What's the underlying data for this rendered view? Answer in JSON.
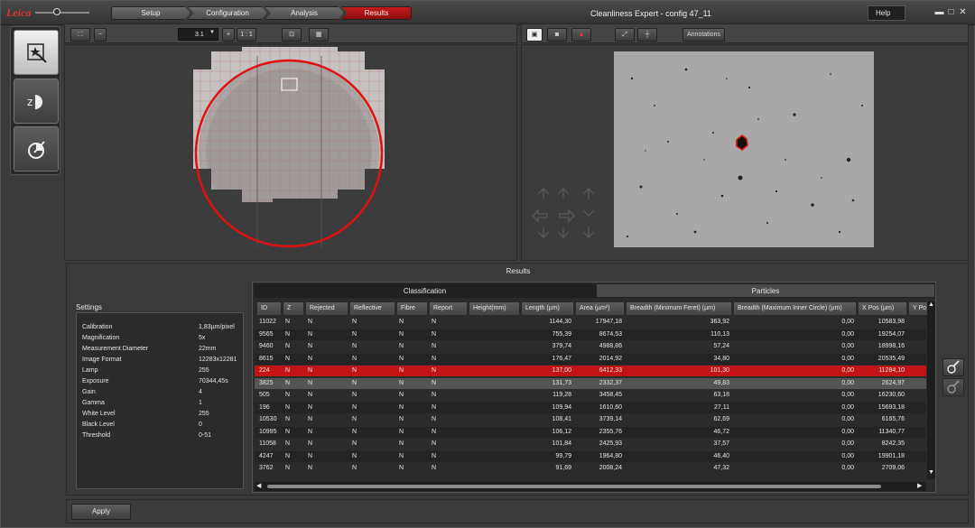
{
  "titlebar": {
    "logo": "Leica",
    "workflow": [
      "Setup",
      "Configuration",
      "Analysis",
      "Results"
    ],
    "active_step": "Results",
    "app_title": "Cleanliness Expert - config 47_11",
    "help_label": "Help"
  },
  "toolbar_left": {
    "zoom_value": "3.1",
    "zoom_minus": "−",
    "zoom_plus": "+",
    "zoom_reset": "1 : 1"
  },
  "toolbar_right": {
    "annotations_label": "Annotations"
  },
  "results": {
    "title": "Results",
    "group_classification": "Classification",
    "group_particles": "Particles",
    "settings_title": "Settings",
    "settings": [
      {
        "key": "Calibration",
        "value": "1,83µm/pixel"
      },
      {
        "key": "Magnification",
        "value": "5x"
      },
      {
        "key": "Measurement Diameter",
        "value": "22mm"
      },
      {
        "key": "Image Format",
        "value": "12283x12281"
      },
      {
        "key": "Lamp",
        "value": "255"
      },
      {
        "key": "Exposure",
        "value": "70344,45s"
      },
      {
        "key": "Gain",
        "value": "4"
      },
      {
        "key": "Gamma",
        "value": "1"
      },
      {
        "key": "White Level",
        "value": "255"
      },
      {
        "key": "Black Level",
        "value": "0"
      },
      {
        "key": "Threshold",
        "value": "0-51"
      }
    ],
    "columns": [
      "ID",
      "Z",
      "Rejected",
      "Reflective",
      "Fibre",
      "Report",
      "Height(mm)",
      "Length (µm)",
      "Area (µm²)",
      "Breadth (Minimum Feret) (µm)",
      "Breadth (Maximum Inner Circle) (µm)",
      "X Pos (µm)",
      "Y Po"
    ],
    "rows": [
      [
        "11022",
        "N",
        "N",
        "N",
        "N",
        "N",
        "",
        "1144,30",
        "17947,18",
        "363,92",
        "0,00",
        "10583,98"
      ],
      [
        "9565",
        "N",
        "N",
        "N",
        "N",
        "N",
        "",
        "755,39",
        "8674,53",
        "110,13",
        "0,00",
        "19254,07"
      ],
      [
        "9460",
        "N",
        "N",
        "N",
        "N",
        "N",
        "",
        "379,74",
        "4988,86",
        "57,24",
        "0,00",
        "18998,16"
      ],
      [
        "8615",
        "N",
        "N",
        "N",
        "N",
        "N",
        "",
        "176,47",
        "2014,92",
        "34,80",
        "0,00",
        "20535,49"
      ],
      [
        "224",
        "N",
        "N",
        "N",
        "N",
        "N",
        "",
        "137,00",
        "6412,33",
        "101,30",
        "0,00",
        "11284,10"
      ],
      [
        "3825",
        "N",
        "N",
        "N",
        "N",
        "N",
        "",
        "131,73",
        "2332,37",
        "49,83",
        "0,00",
        "2624,97"
      ],
      [
        "505",
        "N",
        "N",
        "N",
        "N",
        "N",
        "",
        "119,28",
        "3458,45",
        "63,18",
        "0,00",
        "16230,60"
      ],
      [
        "196",
        "N",
        "N",
        "N",
        "N",
        "N",
        "",
        "109,94",
        "1610,60",
        "27,11",
        "0,00",
        "15693,18"
      ],
      [
        "10530",
        "N",
        "N",
        "N",
        "N",
        "N",
        "",
        "108,41",
        "3739,14",
        "62,69",
        "0,00",
        "6165,76"
      ],
      [
        "10995",
        "N",
        "N",
        "N",
        "N",
        "N",
        "",
        "106,12",
        "2355,76",
        "46,72",
        "0,00",
        "11340,77"
      ],
      [
        "11058",
        "N",
        "N",
        "N",
        "N",
        "N",
        "",
        "101,84",
        "2425,93",
        "37,57",
        "0,00",
        "8242,35"
      ],
      [
        "4247",
        "N",
        "N",
        "N",
        "N",
        "N",
        "",
        "99,79",
        "1964,80",
        "46,40",
        "0,00",
        "19901,18"
      ],
      [
        "3762",
        "N",
        "N",
        "N",
        "N",
        "N",
        "",
        "91,69",
        "2008,24",
        "47,32",
        "0,00",
        "2709,06"
      ]
    ],
    "selected_row_index": 4,
    "hover_row_index": 5
  },
  "bottom": {
    "apply_label": "Apply"
  },
  "colors": {
    "accent": "#c21414",
    "wafer_circle": "#e01010"
  }
}
